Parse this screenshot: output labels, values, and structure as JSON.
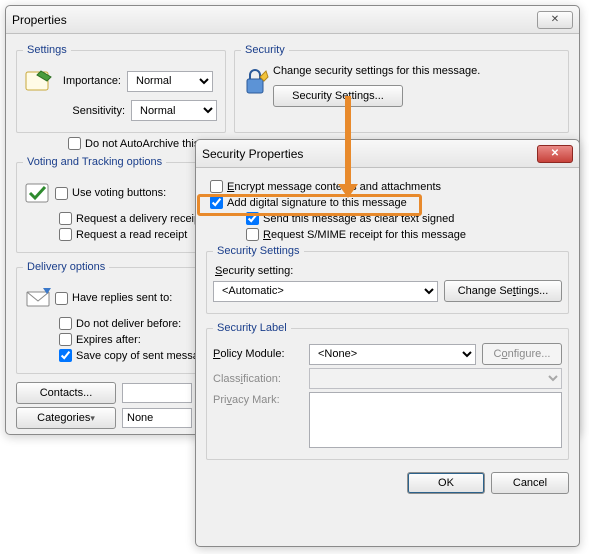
{
  "props": {
    "title": "Properties",
    "close_sym": "✕",
    "settings_legend": "Settings",
    "importance_label": "Importance:",
    "importance_value": "Normal",
    "sensitivity_label": "Sensitivity:",
    "sensitivity_value": "Normal",
    "autoarchive_label": "Do not AutoArchive this item",
    "security_legend": "Security",
    "security_text": "Change security settings for this message.",
    "security_btn": "Security Settings...",
    "voting_legend": "Voting and Tracking options",
    "use_voting_label": "Use voting buttons:",
    "delivery_receipt_label": "Request a delivery receipt",
    "read_receipt_label": "Request a read receipt",
    "delivery_legend": "Delivery options",
    "have_replies_label": "Have replies sent to:",
    "not_before_label": "Do not deliver before:",
    "expires_after_label": "Expires after:",
    "save_copy_label": "Save copy of sent messages",
    "contacts_btn": "Contacts...",
    "categories_btn": "Categories",
    "categories_value": "None"
  },
  "sec": {
    "title": "Security Properties",
    "close_sym": "✕",
    "encrypt_label": "Encrypt message contents and attachments",
    "sign_label": "Add digital signature to this message",
    "cleartext_label": "Send this message as clear text signed",
    "smime_label": "Request S/MIME receipt for this message",
    "settings_legend": "Security Settings",
    "setting_label": "Security setting:",
    "setting_value": "<Automatic>",
    "change_btn": "Change Settings...",
    "label_legend": "Security Label",
    "policy_label": "Policy Module:",
    "policy_value": "<None>",
    "configure_btn": "Configure...",
    "classification_label": "Classification:",
    "privacy_label": "Privacy Mark:",
    "ok_btn": "OK",
    "cancel_btn": "Cancel"
  },
  "icons": {
    "note": "note-icon",
    "lock": "lock-icon",
    "vote": "vote-icon",
    "delivery": "delivery-icon"
  }
}
